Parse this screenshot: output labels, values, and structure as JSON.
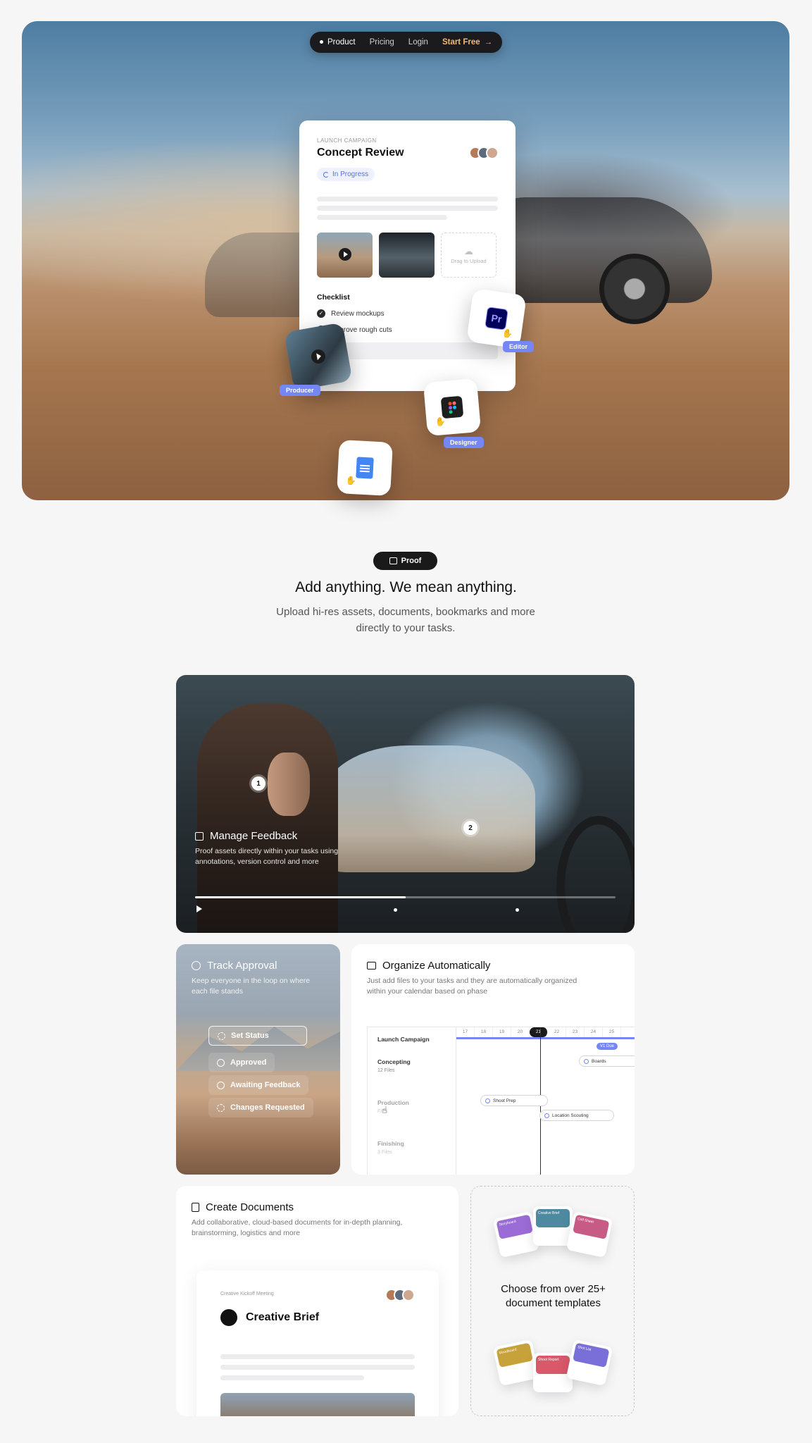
{
  "nav": {
    "items": [
      "Product",
      "Pricing",
      "Login"
    ],
    "cta": "Start Free",
    "cta_arrow": "→"
  },
  "task_card": {
    "eyebrow": "LAUNCH CAMPAIGN",
    "title": "Concept Review",
    "status": "In Progress",
    "upload_hint": "Drag to Upload",
    "checklist_title": "Checklist",
    "checklist": [
      "Review mockups",
      "Approve rough cuts"
    ]
  },
  "roles": {
    "editor": "Editor",
    "producer": "Producer",
    "designer": "Designer"
  },
  "section": {
    "pill": "Proof",
    "headline": "Add anything. We mean anything.",
    "subline": "Upload hi-res assets, documents, bookmarks and more directly to your tasks."
  },
  "feedback": {
    "title": "Manage Feedback",
    "desc": "Proof assets directly within your tasks using annotations, version control and more",
    "markers": [
      "1",
      "2"
    ],
    "progress": 0.5
  },
  "approval": {
    "title": "Track Approval",
    "desc": "Keep everyone in the loop on where each file stands",
    "set_status": "Set Status",
    "options": [
      "Approved",
      "Awaiting Feedback",
      "Changes Requested"
    ]
  },
  "organize": {
    "title": "Organize Automatically",
    "desc": "Just add files to your tasks and they are automatically organized within your calendar based on phase",
    "project": "Launch Campaign",
    "phases": [
      {
        "name": "Concepting",
        "files": "12 Files"
      },
      {
        "name": "Production",
        "files": "Files"
      },
      {
        "name": "Finishing",
        "files": "3 Files"
      }
    ],
    "dates": [
      "17",
      "18",
      "19",
      "20",
      "21",
      "22",
      "23",
      "24",
      "25"
    ],
    "today": "21",
    "first_tag": "V1 Due",
    "bars": [
      "Boards",
      "Shoot Prep",
      "Location Scouting"
    ]
  },
  "docs": {
    "title": "Create Documents",
    "desc": "Add collaborative, cloud-based documents for in-depth planning, brainstorming, logistics and more",
    "meta": "Creative Kickoff Meeting",
    "doc_title": "Creative Brief"
  },
  "templates": {
    "label": "Choose from over 25+ document templates",
    "cards": [
      {
        "title": "Storyboard",
        "color": "#9b6bd6"
      },
      {
        "title": "Creative Brief",
        "color": "#4d8aa0"
      },
      {
        "title": "Call Sheet",
        "color": "#c85a86"
      },
      {
        "title": "Moodboard",
        "color": "#c7a23a"
      },
      {
        "title": "Shoot Report",
        "color": "#d8596a"
      },
      {
        "title": "Shot List",
        "color": "#7a6fd8"
      }
    ]
  },
  "colors": {
    "accent": "#7487f5",
    "cta": "#f1b971",
    "dark": "#1a1a1b"
  }
}
